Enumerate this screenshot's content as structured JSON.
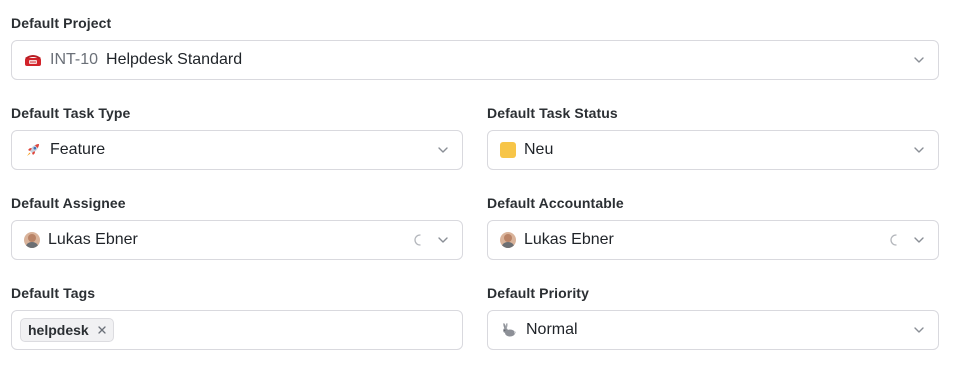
{
  "project": {
    "label": "Default Project",
    "key": "INT-10",
    "name": "Helpdesk Standard",
    "icon": "telephone-icon"
  },
  "task_type": {
    "label": "Default Task Type",
    "value": "Feature",
    "icon": "rocket-icon"
  },
  "task_status": {
    "label": "Default Task Status",
    "value": "Neu",
    "color": "#f7c548"
  },
  "assignee": {
    "label": "Default Assignee",
    "value": "Lukas Ebner"
  },
  "accountable": {
    "label": "Default Accountable",
    "value": "Lukas Ebner"
  },
  "tags": {
    "label": "Default Tags",
    "items": [
      "helpdesk"
    ]
  },
  "priority": {
    "label": "Default Priority",
    "value": "Normal",
    "icon": "rabbit-icon"
  }
}
